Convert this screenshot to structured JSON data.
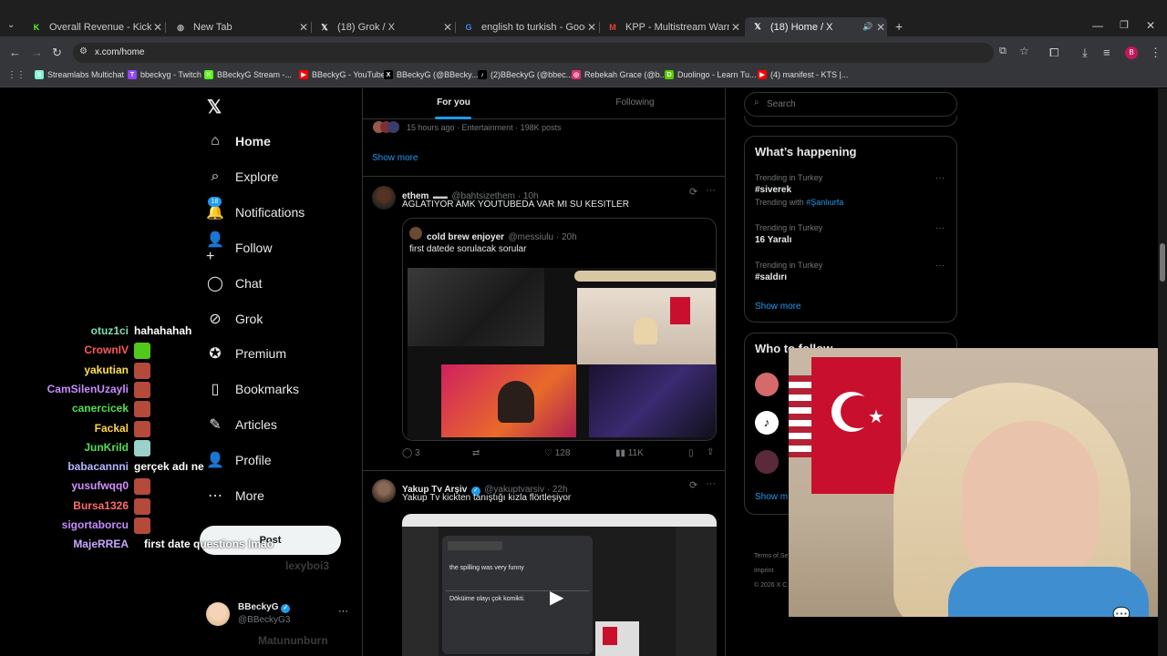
{
  "browser": {
    "tabs": [
      {
        "title": "Overall Revenue - Kick Dashbo...",
        "icon": "kick-icon",
        "color": "#53fc18"
      },
      {
        "title": "New Tab",
        "icon": "chrome-icon",
        "color": "#8ab4f8"
      },
      {
        "title": "(18) Grok / X",
        "icon": "x-icon",
        "color": "#ffffff"
      },
      {
        "title": "english to turkish - Google Sea...",
        "icon": "google-icon",
        "color": "#4285f4"
      },
      {
        "title": "KPP - Multistream Warning - b...",
        "icon": "gmail-icon",
        "color": "#ea4335"
      },
      {
        "title": "(18) Home / X",
        "icon": "x-icon",
        "color": "#ffffff"
      }
    ],
    "new_tab": "+",
    "url": "x.com/home",
    "bookmarks": [
      {
        "label": "Streamlabs Multichat",
        "color": "#80f5d2",
        "glyph": "S"
      },
      {
        "label": "bbeckyg - Twitch",
        "color": "#9146ff",
        "glyph": "T"
      },
      {
        "label": "BBeckyG Stream -...",
        "color": "#53fc18",
        "glyph": "K"
      },
      {
        "label": "BBeckyG - YouTube",
        "color": "#ff0000",
        "glyph": "▶"
      },
      {
        "label": "BBeckyG (@BBecky...",
        "color": "#000000",
        "glyph": "X"
      },
      {
        "label": "(2)BBeckyG (@bbec...",
        "color": "#000000",
        "glyph": "♪"
      },
      {
        "label": "Rebekah Grace (@b...",
        "color": "#e1306c",
        "glyph": "◎"
      },
      {
        "label": "Duolingo - Learn Tu...",
        "color": "#58cc02",
        "glyph": "D"
      },
      {
        "label": "(4) manifest - KTS |...",
        "color": "#ff0000",
        "glyph": "▶"
      }
    ]
  },
  "nav": {
    "items": [
      {
        "label": "Home",
        "icon": "home-icon"
      },
      {
        "label": "Explore",
        "icon": "search-icon"
      },
      {
        "label": "Notifications",
        "icon": "bell-icon",
        "badge": "18"
      },
      {
        "label": "Follow",
        "icon": "follow-icon"
      },
      {
        "label": "Chat",
        "icon": "chat-icon"
      },
      {
        "label": "Grok",
        "icon": "grok-icon"
      },
      {
        "label": "Premium",
        "icon": "premium-icon"
      },
      {
        "label": "Bookmarks",
        "icon": "bookmark-icon"
      },
      {
        "label": "Articles",
        "icon": "articles-icon"
      },
      {
        "label": "Profile",
        "icon": "profile-icon"
      },
      {
        "label": "More",
        "icon": "more-icon"
      }
    ],
    "post_button": "Post",
    "account": {
      "name": "BBeckyG",
      "handle": "@BBeckyG3",
      "more": "···"
    }
  },
  "feed": {
    "tabs": [
      "For you",
      "Following"
    ],
    "trend_meta": "15 hours ago · Entertainment · 198K posts",
    "show_more": "Show more",
    "tweets": [
      {
        "name": "ethem",
        "handle": "@bahtsizethem · 10h",
        "text": "AGLATIYOR AMK YOUTUBEDA VAR MI SU KESITLER",
        "quote": {
          "name": "cold brew enjoyer",
          "handle": "@messiulu · 20h",
          "text": "first datede sorulacak sorular"
        },
        "stats": {
          "replies": "3",
          "reposts": "",
          "likes": "128",
          "views": "11K"
        }
      },
      {
        "name": "Yakup Tv Arşiv",
        "handle": "@yakuptvarsiv · 22h",
        "text": "Yakup Tv kickten tanıştığı kızla flörtleşiyor",
        "video_lines": [
          "the spilling was very funny",
          "Döküime olayı çok komikti."
        ]
      }
    ]
  },
  "sidebar": {
    "search_placeholder": "Search",
    "happening_title": "What’s happening",
    "trends": [
      {
        "meta": "Trending in Turkey",
        "title": "#siverek",
        "with_label": "Trending with",
        "with_tag": "#Şanlıurfa"
      },
      {
        "meta": "Trending in Turkey",
        "title": "16 Yaralı"
      },
      {
        "meta": "Trending in Turkey",
        "title": "#saldırı"
      }
    ],
    "show_more": "Show more",
    "who_to_follow": "Who to follow",
    "footer": [
      "Terms of Se",
      "Imprint",
      "© 2026 X C"
    ]
  },
  "chat": [
    {
      "user": "otuz1ci",
      "color": "#7fdfb0",
      "msg": "hahahahah"
    },
    {
      "user": "CrownIV",
      "color": "#ff5a5a",
      "emote": "#53c81c"
    },
    {
      "user": "yakutian",
      "color": "#ffe14d",
      "emote": "#b44a3a"
    },
    {
      "user": "CamSilenUzayli",
      "color": "#c58cff",
      "emote": "#b44a3a"
    },
    {
      "user": "canercicek",
      "color": "#4fe04f",
      "emote": "#b44a3a"
    },
    {
      "user": "Fackal",
      "color": "#ffd54a",
      "emote": "#b44a3a"
    },
    {
      "user": "JunKrild",
      "color": "#4fe04f",
      "emote": "#9ad1c8"
    },
    {
      "user": "babacannni",
      "color": "#b9b4ff",
      "msg": "gerçek adı ne"
    },
    {
      "user": "yusufwqq0",
      "color": "#d291ff",
      "emote": "#b44a3a"
    },
    {
      "user": "Bursa1326",
      "color": "#ff6b6b",
      "emote": "#b44a3a"
    },
    {
      "user": "sigortaborcu",
      "color": "#c58cff",
      "emote": "#b44a3a"
    },
    {
      "user": "MajeRREA",
      "color": "#c9a8ff",
      "msg": "first date questions lmao"
    }
  ],
  "chat_faded": [
    "lexyboi3",
    "Matununburn"
  ],
  "colors": {
    "accent": "#1d9bf0",
    "bg": "#000000",
    "border": "#2f3336"
  }
}
